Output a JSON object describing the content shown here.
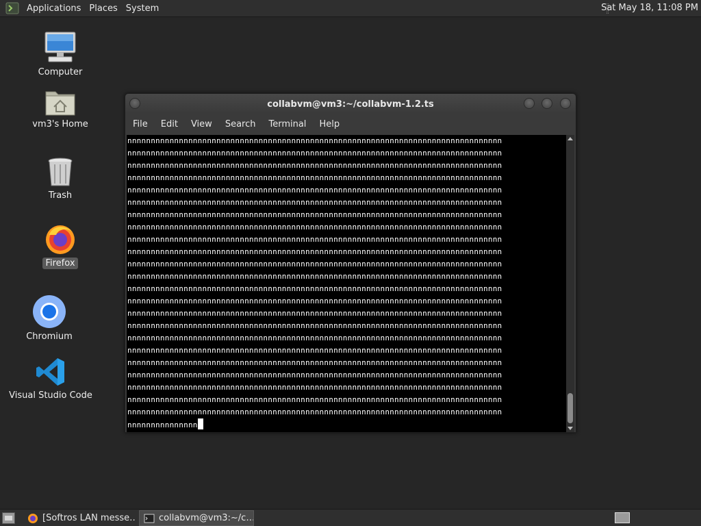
{
  "top_panel": {
    "menus": [
      "Applications",
      "Places",
      "System"
    ],
    "clock": "Sat May 18, 11:08 PM"
  },
  "desktop": {
    "icons": [
      {
        "label": "Computer",
        "icon": "computer-icon"
      },
      {
        "label": "vm3's Home",
        "icon": "home-folder-icon"
      },
      {
        "label": "Trash",
        "icon": "trash-icon"
      },
      {
        "label": "Firefox",
        "icon": "firefox-icon",
        "selected": true
      },
      {
        "label": "Chromium",
        "icon": "chromium-icon"
      },
      {
        "label": "Visual Studio Code",
        "icon": "vscode-icon"
      }
    ]
  },
  "terminal": {
    "title": "collabvm@vm3:~/collabvm-1.2.ts",
    "menu": [
      "File",
      "Edit",
      "View",
      "Search",
      "Terminal",
      "Help"
    ],
    "lines": [
      "nnnnnnnnnnnnnnnnnnnnnnnnnnnnnnnnnnnnnnnnnnnnnnnnnnnnnnnnnnnnnnnnnnnnnnnnnnnnnnnn",
      "nnnnnnnnnnnnnnnnnnnnnnnnnnnnnnnnnnnnnnnnnnnnnnnnnnnnnnnnnnnnnnnnnnnnnnnnnnnnnnnn",
      "nnnnnnnnnnnnnnnnnnnnnnnnnnnnnnnnnnnnnnnnnnnnnnnnnnnnnnnnnnnnnnnnnnnnnnnnnnnnnnnn",
      "nnnnnnnnnnnnnnnnnnnnnnnnnnnnnnnnnnnnnnnnnnnnnnnnnnnnnnnnnnnnnnnnnnnnnnnnnnnnnnnn",
      "nnnnnnnnnnnnnnnnnnnnnnnnnnnnnnnnnnnnnnnnnnnnnnnnnnnnnnnnnnnnnnnnnnnnnnnnnnnnnnnn",
      "nnnnnnnnnnnnnnnnnnnnnnnnnnnnnnnnnnnnnnnnnnnnnnnnnnnnnnnnnnnnnnnnnnnnnnnnnnnnnnnn",
      "nnnnnnnnnnnnnnnnnnnnnnnnnnnnnnnnnnnnnnnnnnnnnnnnnnnnnnnnnnnnnnnnnnnnnnnnnnnnnnnn",
      "nnnnnnnnnnnnnnnnnnnnnnnnnnnnnnnnnnnnnnnnnnnnnnnnnnnnnnnnnnnnnnnnnnnnnnnnnnnnnnnn",
      "nnnnnnnnnnnnnnnnnnnnnnnnnnnnnnnnnnnnnnnnnnnnnnnnnnnnnnnnnnnnnnnnnnnnnnnnnnnnnnnn",
      "nnnnnnnnnnnnnnnnnnnnnnnnnnnnnnnnnnnnnnnnnnnnnnnnnnnnnnnnnnnnnnnnnnnnnnnnnnnnnnnn",
      "nnnnnnnnnnnnnnnnnnnnnnnnnnnnnnnnnnnnnnnnnnnnnnnnnnnnnnnnnnnnnnnnnnnnnnnnnnnnnnnn",
      "nnnnnnnnnnnnnnnnnnnnnnnnnnnnnnnnnnnnnnnnnnnnnnnnnnnnnnnnnnnnnnnnnnnnnnnnnnnnnnnn",
      "nnnnnnnnnnnnnnnnnnnnnnnnnnnnnnnnnnnnnnnnnnnnnnnnnnnnnnnnnnnnnnnnnnnnnnnnnnnnnnnn",
      "nnnnnnnnnnnnnnnnnnnnnnnnnnnnnnnnnnnnnnnnnnnnnnnnnnnnnnnnnnnnnnnnnnnnnnnnnnnnnnnn",
      "nnnnnnnnnnnnnnnnnnnnnnnnnnnnnnnnnnnnnnnnnnnnnnnnnnnnnnnnnnnnnnnnnnnnnnnnnnnnnnnn",
      "nnnnnnnnnnnnnnnnnnnnnnnnnnnnnnnnnnnnnnnnnnnnnnnnnnnnnnnnnnnnnnnnnnnnnnnnnnnnnnnn",
      "nnnnnnnnnnnnnnnnnnnnnnnnnnnnnnnnnnnnnnnnnnnnnnnnnnnnnnnnnnnnnnnnnnnnnnnnnnnnnnnn",
      "nnnnnnnnnnnnnnnnnnnnnnnnnnnnnnnnnnnnnnnnnnnnnnnnnnnnnnnnnnnnnnnnnnnnnnnnnnnnnnnn",
      "nnnnnnnnnnnnnnnnnnnnnnnnnnnnnnnnnnnnnnnnnnnnnnnnnnnnnnnnnnnnnnnnnnnnnnnnnnnnnnnn",
      "nnnnnnnnnnnnnnnnnnnnnnnnnnnnnnnnnnnnnnnnnnnnnnnnnnnnnnnnnnnnnnnnnnnnnnnnnnnnnnnn",
      "nnnnnnnnnnnnnnnnnnnnnnnnnnnnnnnnnnnnnnnnnnnnnnnnnnnnnnnnnnnnnnnnnnnnnnnnnnnnnnnn",
      "nnnnnnnnnnnnnnnnnnnnnnnnnnnnnnnnnnnnnnnnnnnnnnnnnnnnnnnnnnnnnnnnnnnnnnnnnnnnnnnn",
      "nnnnnnnnnnnnnnnnnnnnnnnnnnnnnnnnnnnnnnnnnnnnnnnnnnnnnnnnnnnnnnnnnnnnnnnnnnnnnnnn"
    ],
    "last_line": "nnnnnnnnnnnnnnn"
  },
  "taskbar": {
    "tasks": [
      {
        "label": "[Softros LAN messe…",
        "icon": "firefox-icon",
        "active": false
      },
      {
        "label": "collabvm@vm3:~/c…",
        "icon": "terminal-icon",
        "active": true
      }
    ]
  }
}
